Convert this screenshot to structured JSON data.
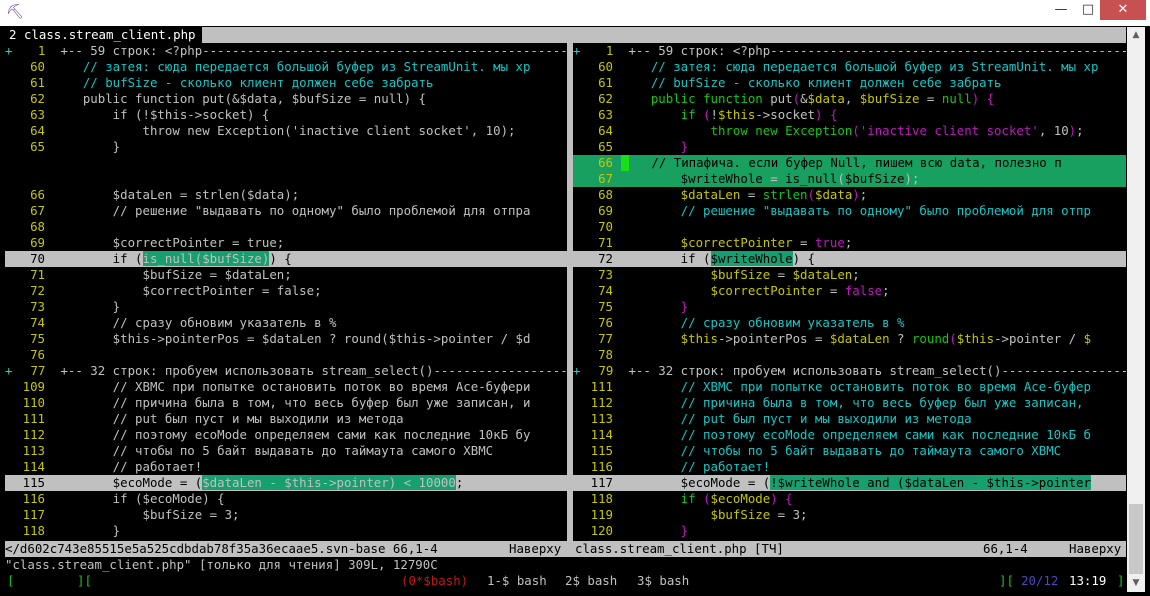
{
  "window": {
    "icon": "putty-icon",
    "minimize": "—",
    "maximize": "□",
    "close": "✕"
  },
  "tab": {
    "number": "2",
    "name": "class.stream_client.php"
  },
  "left_rows": [
    {
      "k": "fold",
      "g": "+  ",
      "n": "1",
      "t": " +-- 59 строк: <?php----------------------------------------------------------"
    },
    {
      "n": "60",
      "s": [
        [
          "c",
          "    // затея: сюда передается большой буфер из StreamUnit. мы хр"
        ]
      ]
    },
    {
      "n": "61",
      "s": [
        [
          "c",
          "    // bufSize - сколько клиент должен себе забрать"
        ]
      ]
    },
    {
      "n": "62",
      "s": [
        [
          "p",
          "    public function put(&$data, $bufSize = null) {"
        ]
      ]
    },
    {
      "n": "63",
      "s": [
        [
          "p",
          "        if (!$this->socket) {"
        ]
      ]
    },
    {
      "n": "64",
      "s": [
        [
          "p",
          "            throw new Exception('inactive client socket', 10);"
        ]
      ]
    },
    {
      "n": "65",
      "s": [
        [
          "p",
          "        }"
        ]
      ]
    },
    {
      "k": "filler"
    },
    {
      "k": "filler"
    },
    {
      "n": "66",
      "s": [
        [
          "p",
          "        $dataLen = strlen($data);"
        ]
      ]
    },
    {
      "n": "67",
      "s": [
        [
          "p",
          "        // решение \"выдавать по одному\" было проблемой для отпра"
        ]
      ]
    },
    {
      "n": "68",
      "s": [
        [
          "p",
          ""
        ]
      ]
    },
    {
      "n": "69",
      "s": [
        [
          "p",
          "        $correctPointer = true;"
        ]
      ]
    },
    {
      "k": "chg",
      "n": "70",
      "s": [
        [
          "p",
          "        if ("
        ],
        [
          "h",
          "is_null($bufSize)"
        ],
        [
          "p",
          ") {"
        ]
      ]
    },
    {
      "n": "71",
      "s": [
        [
          "p",
          "            $bufSize = $dataLen;"
        ]
      ]
    },
    {
      "n": "72",
      "s": [
        [
          "p",
          "            $correctPointer = false;"
        ]
      ]
    },
    {
      "n": "73",
      "s": [
        [
          "p",
          "        }"
        ]
      ]
    },
    {
      "n": "74",
      "s": [
        [
          "p",
          "        // сразу обновим указатель в %"
        ]
      ]
    },
    {
      "n": "75",
      "s": [
        [
          "p",
          "        $this->pointerPos = $dataLen ? round($this->pointer / $d"
        ]
      ]
    },
    {
      "n": "76",
      "s": [
        [
          "p",
          ""
        ]
      ]
    },
    {
      "k": "fold",
      "g": "+  ",
      "n": "77",
      "t": " +-- 32 строк: пробуем использовать stream_select()---------------------------"
    },
    {
      "n": "109",
      "s": [
        [
          "p",
          "        // ХВМС при попытке остановить поток во время Ace-буфери"
        ]
      ]
    },
    {
      "n": "110",
      "s": [
        [
          "p",
          "        // причина была в том, что весь буфер был уже записан, и"
        ]
      ]
    },
    {
      "n": "111",
      "s": [
        [
          "p",
          "        // put был пуст и мы выходили из метода"
        ]
      ]
    },
    {
      "n": "112",
      "s": [
        [
          "p",
          "        // поэтому ecoMode определяем сами как последние 10кБ бу"
        ]
      ]
    },
    {
      "n": "113",
      "s": [
        [
          "p",
          "        // чтобы по 5 байт выдавать до таймаута самого ХВМС"
        ]
      ]
    },
    {
      "n": "114",
      "s": [
        [
          "p",
          "        // работает!"
        ]
      ]
    },
    {
      "k": "chg",
      "n": "115",
      "s": [
        [
          "p",
          "        $ecoMode = ("
        ],
        [
          "h",
          "$dataLen - $this->pointer) < 10000"
        ],
        [
          "p",
          ";"
        ]
      ]
    },
    {
      "n": "116",
      "s": [
        [
          "p",
          "        if ($ecoMode) {"
        ]
      ]
    },
    {
      "n": "117",
      "s": [
        [
          "p",
          "            $bufSize = 3;"
        ]
      ]
    },
    {
      "n": "118",
      "s": [
        [
          "p",
          "        }"
        ]
      ]
    }
  ],
  "right_rows": [
    {
      "k": "fold",
      "g": "+  ",
      "n": "1",
      "t": " +-- 59 строк: <?php----------------------------------------------------------"
    },
    {
      "n": "60",
      "s": [
        [
          "c",
          "    // затея: сюда передается большой буфер из StreamUnit. мы хр"
        ]
      ]
    },
    {
      "n": "61",
      "s": [
        [
          "c",
          "    // bufSize - сколько клиент должен себе забрать"
        ]
      ]
    },
    {
      "n": "62",
      "s": [
        [
          "k",
          "    public"
        ],
        [
          "p",
          " "
        ],
        [
          "k",
          "function"
        ],
        [
          "p",
          " put"
        ],
        [
          "st",
          "("
        ],
        [
          "p",
          "&"
        ],
        [
          "v",
          "$data"
        ],
        [
          "p",
          ", "
        ],
        [
          "v",
          "$bufSize"
        ],
        [
          "p",
          " = "
        ],
        [
          "k",
          "null"
        ],
        [
          "st",
          ")"
        ],
        [
          "p",
          " "
        ],
        [
          "st",
          "{"
        ]
      ]
    },
    {
      "n": "63",
      "s": [
        [
          "k",
          "        if"
        ],
        [
          "p",
          " "
        ],
        [
          "st",
          "("
        ],
        [
          "p",
          "!"
        ],
        [
          "v",
          "$this"
        ],
        [
          "p",
          "->socket"
        ],
        [
          "st",
          ")"
        ],
        [
          "p",
          " "
        ],
        [
          "st",
          "{"
        ]
      ]
    },
    {
      "n": "64",
      "s": [
        [
          "k",
          "            throw"
        ],
        [
          "p",
          " "
        ],
        [
          "k",
          "new"
        ],
        [
          "p",
          " "
        ],
        [
          "t",
          "Exception"
        ],
        [
          "st",
          "("
        ],
        [
          "st",
          "'inactive client socket'"
        ],
        [
          "p",
          ", 10"
        ],
        [
          "st",
          ")"
        ],
        [
          "p",
          ";"
        ]
      ]
    },
    {
      "n": "65",
      "s": [
        [
          "st",
          "        }"
        ]
      ]
    },
    {
      "k": "add",
      "n": "66",
      "cursor": true,
      "s": [
        [
          "c",
          "    // Типафича. если буфер Null, пишем всю data, полезно п"
        ]
      ]
    },
    {
      "k": "add",
      "n": "67",
      "s": [
        [
          "v",
          "        $writeWhole"
        ],
        [
          "p",
          " = "
        ],
        [
          "k",
          "is_null"
        ],
        [
          "p",
          "("
        ],
        [
          "v",
          "$bufSize"
        ],
        [
          "p",
          ");"
        ]
      ]
    },
    {
      "n": "68",
      "s": [
        [
          "v",
          "        $dataLen"
        ],
        [
          "p",
          " = "
        ],
        [
          "t",
          "strlen"
        ],
        [
          "st",
          "("
        ],
        [
          "v",
          "$data"
        ],
        [
          "st",
          ")"
        ],
        [
          "p",
          ";"
        ]
      ]
    },
    {
      "n": "69",
      "s": [
        [
          "c",
          "        // решение \"выдавать по одному\" было проблемой для отпр"
        ]
      ]
    },
    {
      "n": "70",
      "s": [
        [
          "p",
          ""
        ]
      ]
    },
    {
      "n": "71",
      "s": [
        [
          "v",
          "        $correctPointer"
        ],
        [
          "p",
          " = "
        ],
        [
          "st",
          "true"
        ],
        [
          "p",
          ";"
        ]
      ]
    },
    {
      "k": "chg",
      "n": "72",
      "s": [
        [
          "p",
          "        if ("
        ],
        [
          "h",
          "$writeWhole"
        ],
        [
          "p",
          ") {"
        ]
      ]
    },
    {
      "n": "73",
      "s": [
        [
          "v",
          "            $bufSize"
        ],
        [
          "p",
          " = "
        ],
        [
          "v",
          "$dataLen"
        ],
        [
          "p",
          ";"
        ]
      ]
    },
    {
      "n": "74",
      "s": [
        [
          "v",
          "            $correctPointer"
        ],
        [
          "p",
          " = "
        ],
        [
          "st",
          "false"
        ],
        [
          "p",
          ";"
        ]
      ]
    },
    {
      "n": "75",
      "s": [
        [
          "st",
          "        }"
        ]
      ]
    },
    {
      "n": "76",
      "s": [
        [
          "c",
          "        // сразу обновим указатель в %"
        ]
      ]
    },
    {
      "n": "77",
      "s": [
        [
          "v",
          "        $this"
        ],
        [
          "p",
          "->pointerPos = "
        ],
        [
          "v",
          "$dataLen"
        ],
        [
          "p",
          " ? "
        ],
        [
          "t",
          "round"
        ],
        [
          "st",
          "("
        ],
        [
          "v",
          "$this"
        ],
        [
          "p",
          "->pointer / "
        ],
        [
          "v",
          "$"
        ]
      ]
    },
    {
      "n": "78",
      "s": [
        [
          "p",
          ""
        ]
      ]
    },
    {
      "k": "fold",
      "g": "+  ",
      "n": "79",
      "t": " +-- 32 строк: пробуем использовать stream_select()---------------------------"
    },
    {
      "n": "111",
      "s": [
        [
          "c",
          "        // ХВМС при попытке остановить поток во время Ace-буфер"
        ]
      ]
    },
    {
      "n": "112",
      "s": [
        [
          "c",
          "        // причина была в том, что весь буфер был уже записан,"
        ]
      ]
    },
    {
      "n": "113",
      "s": [
        [
          "c",
          "        // put был пуст и мы выходили из метода"
        ]
      ]
    },
    {
      "n": "114",
      "s": [
        [
          "c",
          "        // поэтому ecoMode определяем сами как последние 10кБ б"
        ]
      ]
    },
    {
      "n": "115",
      "s": [
        [
          "c",
          "        // чтобы по 5 байт выдавать до таймаута самого ХВМС"
        ]
      ]
    },
    {
      "n": "116",
      "s": [
        [
          "c",
          "        // работает!"
        ]
      ]
    },
    {
      "k": "chg",
      "n": "117",
      "s": [
        [
          "p",
          "        $ecoMode = ("
        ],
        [
          "h",
          "!$writeWhole and ($dataLen - $this->pointer"
        ]
      ]
    },
    {
      "n": "118",
      "s": [
        [
          "k",
          "        if"
        ],
        [
          "p",
          " "
        ],
        [
          "st",
          "("
        ],
        [
          "v",
          "$ecoMode"
        ],
        [
          "st",
          ")"
        ],
        [
          "p",
          " "
        ],
        [
          "st",
          "{"
        ]
      ]
    },
    {
      "n": "119",
      "s": [
        [
          "v",
          "            $bufSize"
        ],
        [
          "p",
          " = "
        ],
        [
          "p",
          "3;"
        ]
      ]
    },
    {
      "n": "120",
      "s": [
        [
          "st",
          "        }"
        ]
      ]
    }
  ],
  "status": {
    "left_file": "</d602c743e85515e5a525cdbdab78f35a36ecaae5.svn-base 66,1-4",
    "left_pos": "Наверху",
    "right_file": "class.stream_client.php [ТЧ]",
    "right_pos": "66,1-4",
    "right_top": "Наверху"
  },
  "cmdline": "\"class.stream_client.php\" [только для чтения] 309L, 12790C",
  "screen": {
    "lbrack": "[",
    "rbrack1": "][",
    "window0": "(0*$bash)",
    "window1": "1-$ bash",
    "window2": "2$ bash",
    "window3": "3$ bash",
    "rbrack2": "][",
    "date": "20/12",
    "time": "13:19",
    "end": "]"
  },
  "colors": {
    "added_line_bg": "#18a060",
    "changed_line_bg": "#c0c0c0",
    "diff_text_bg": "#16a070",
    "line_number": "#c6c600",
    "comment": "#18c5c5"
  }
}
